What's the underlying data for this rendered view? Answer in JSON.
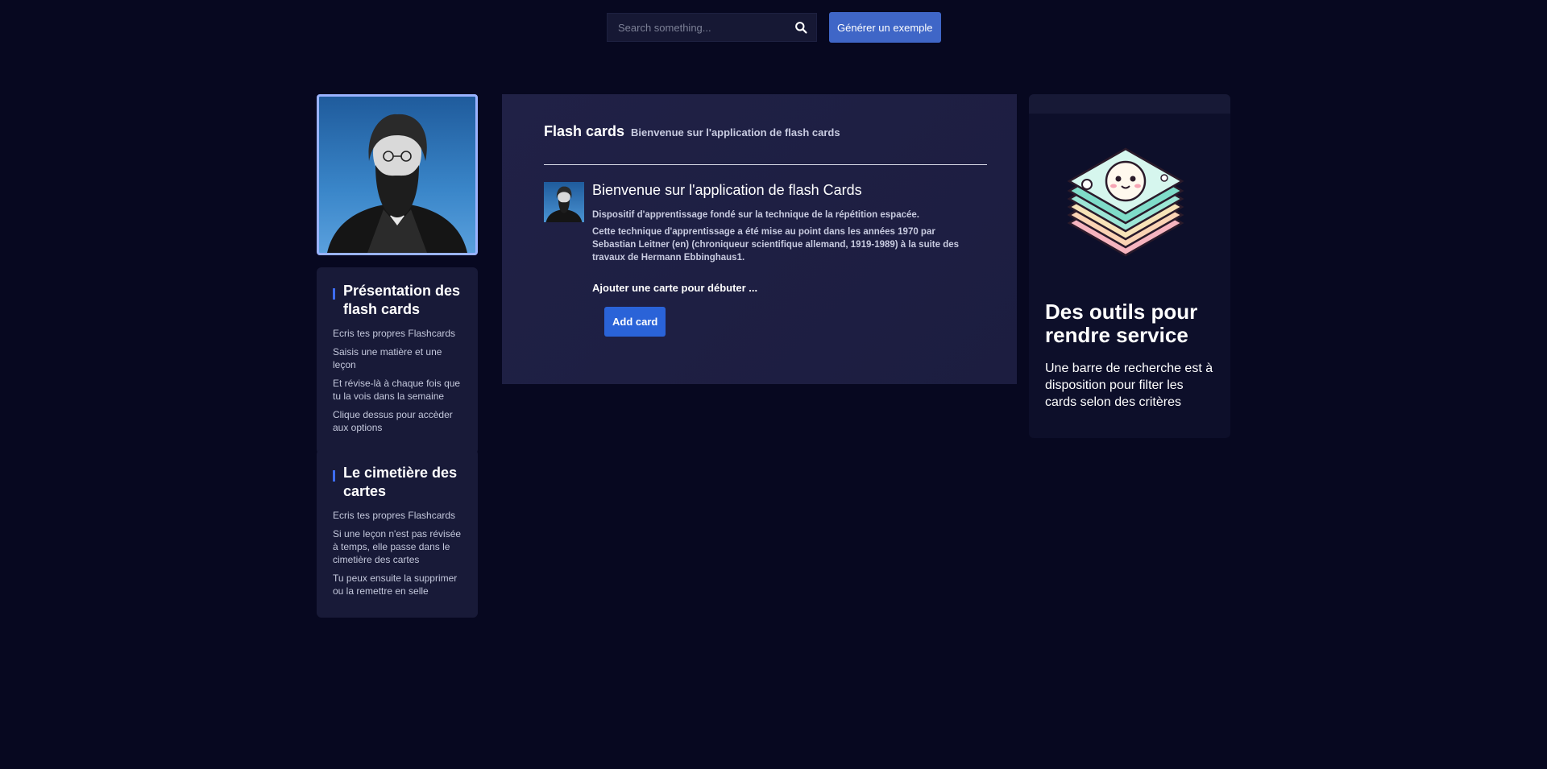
{
  "topbar": {
    "search_placeholder": "Search something...",
    "generate_label": "Générer un exemple"
  },
  "sidebar": {
    "card1": {
      "title": "Présentation des flash cards",
      "items": [
        "Ecris tes propres Flashcards",
        "Saisis une matière et une leçon",
        "Et révise-là à chaque fois que tu la vois dans la semaine",
        "Clique dessus pour accèder aux options"
      ]
    },
    "card2": {
      "title": "Le cimetière des cartes",
      "items": [
        "Ecris tes propres Flashcards",
        "Si une leçon n'est pas révisée à temps, elle passe dans le cimetière des cartes",
        "Tu peux ensuite la supprimer ou la remettre en selle"
      ]
    }
  },
  "main": {
    "title": "Flash cards",
    "subtitle": "Bienvenue sur l'application de flash cards",
    "media_title": "Bienvenue sur l'application de flash Cards",
    "para1": "Dispositif d'apprentissage fondé sur la technique de la répétition espacée.",
    "para2": "Cette technique d'apprentissage a été mise au point dans les années 1970 par Sebastian Leitner (en) (chroniqueur scientifique allemand, 1919-1989) à la suite des travaux de Hermann Ebbinghaus1.",
    "cta": "Ajouter une carte pour débuter ...",
    "add_label": "Add card"
  },
  "right": {
    "title": "Des outils pour rendre service",
    "text": "Une barre de recherche est à disposition pour filter les cards selon des critères"
  },
  "colors": {
    "background": "#070820",
    "panel": "#1e1f44",
    "accent": "#3d6cf0",
    "button": "#2a63d8"
  },
  "icons": [
    "search-icon",
    "portrait-image",
    "card-stack-illustration"
  ]
}
